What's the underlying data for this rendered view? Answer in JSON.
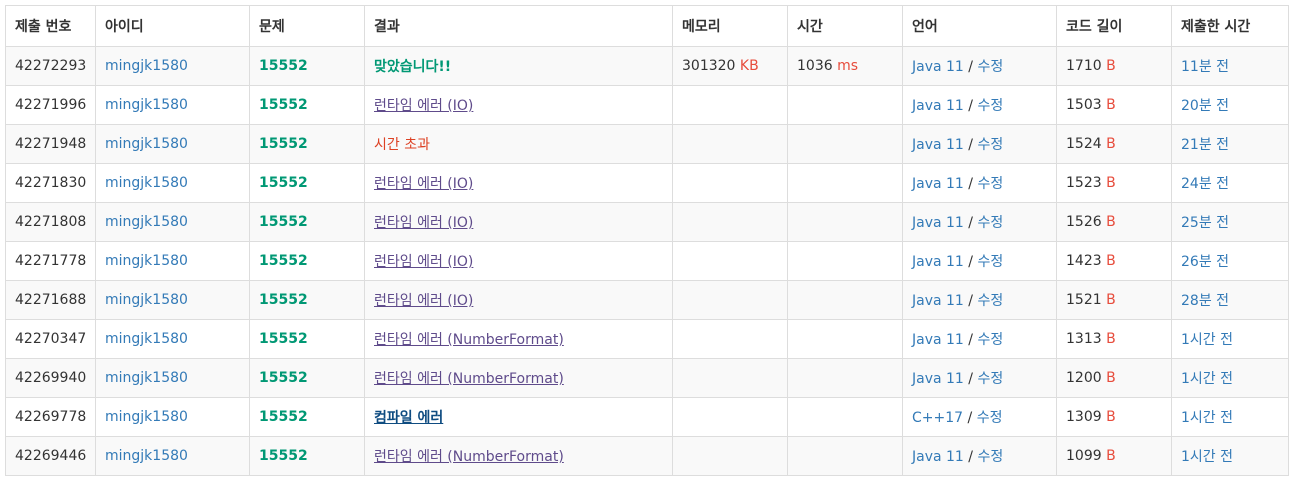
{
  "columns": [
    "제출 번호",
    "아이디",
    "문제",
    "결과",
    "메모리",
    "시간",
    "언어",
    "코드 길이",
    "제출한 시간"
  ],
  "edit_label": "수정",
  "memory_unit": "KB",
  "time_unit": "ms",
  "length_unit": "B",
  "rows": [
    {
      "id": "42272293",
      "user": "mingjk1580",
      "problem": "15552",
      "result": "맞았습니다!!",
      "result_type": "ac",
      "memory": "301320",
      "time": "1036",
      "lang": "Java 11",
      "length": "1710",
      "submitted": "11분 전"
    },
    {
      "id": "42271996",
      "user": "mingjk1580",
      "problem": "15552",
      "result": "런타임 에러 (IO)",
      "result_type": "rte",
      "memory": "",
      "time": "",
      "lang": "Java 11",
      "length": "1503",
      "submitted": "20분 전"
    },
    {
      "id": "42271948",
      "user": "mingjk1580",
      "problem": "15552",
      "result": "시간 초과",
      "result_type": "tle",
      "memory": "",
      "time": "",
      "lang": "Java 11",
      "length": "1524",
      "submitted": "21분 전"
    },
    {
      "id": "42271830",
      "user": "mingjk1580",
      "problem": "15552",
      "result": "런타임 에러 (IO)",
      "result_type": "rte",
      "memory": "",
      "time": "",
      "lang": "Java 11",
      "length": "1523",
      "submitted": "24분 전"
    },
    {
      "id": "42271808",
      "user": "mingjk1580",
      "problem": "15552",
      "result": "런타임 에러 (IO)",
      "result_type": "rte",
      "memory": "",
      "time": "",
      "lang": "Java 11",
      "length": "1526",
      "submitted": "25분 전"
    },
    {
      "id": "42271778",
      "user": "mingjk1580",
      "problem": "15552",
      "result": "런타임 에러 (IO)",
      "result_type": "rte",
      "memory": "",
      "time": "",
      "lang": "Java 11",
      "length": "1423",
      "submitted": "26분 전"
    },
    {
      "id": "42271688",
      "user": "mingjk1580",
      "problem": "15552",
      "result": "런타임 에러 (IO)",
      "result_type": "rte",
      "memory": "",
      "time": "",
      "lang": "Java 11",
      "length": "1521",
      "submitted": "28분 전"
    },
    {
      "id": "42270347",
      "user": "mingjk1580",
      "problem": "15552",
      "result": "런타임 에러 (NumberFormat)",
      "result_type": "rte",
      "memory": "",
      "time": "",
      "lang": "Java 11",
      "length": "1313",
      "submitted": "1시간 전"
    },
    {
      "id": "42269940",
      "user": "mingjk1580",
      "problem": "15552",
      "result": "런타임 에러 (NumberFormat)",
      "result_type": "rte",
      "memory": "",
      "time": "",
      "lang": "Java 11",
      "length": "1200",
      "submitted": "1시간 전"
    },
    {
      "id": "42269778",
      "user": "mingjk1580",
      "problem": "15552",
      "result": "컴파일 에러",
      "result_type": "ce",
      "memory": "",
      "time": "",
      "lang": "C++17",
      "length": "1309",
      "submitted": "1시간 전"
    },
    {
      "id": "42269446",
      "user": "mingjk1580",
      "problem": "15552",
      "result": "런타임 에러 (NumberFormat)",
      "result_type": "rte",
      "memory": "",
      "time": "",
      "lang": "Java 11",
      "length": "1099",
      "submitted": "1시간 전"
    }
  ]
}
